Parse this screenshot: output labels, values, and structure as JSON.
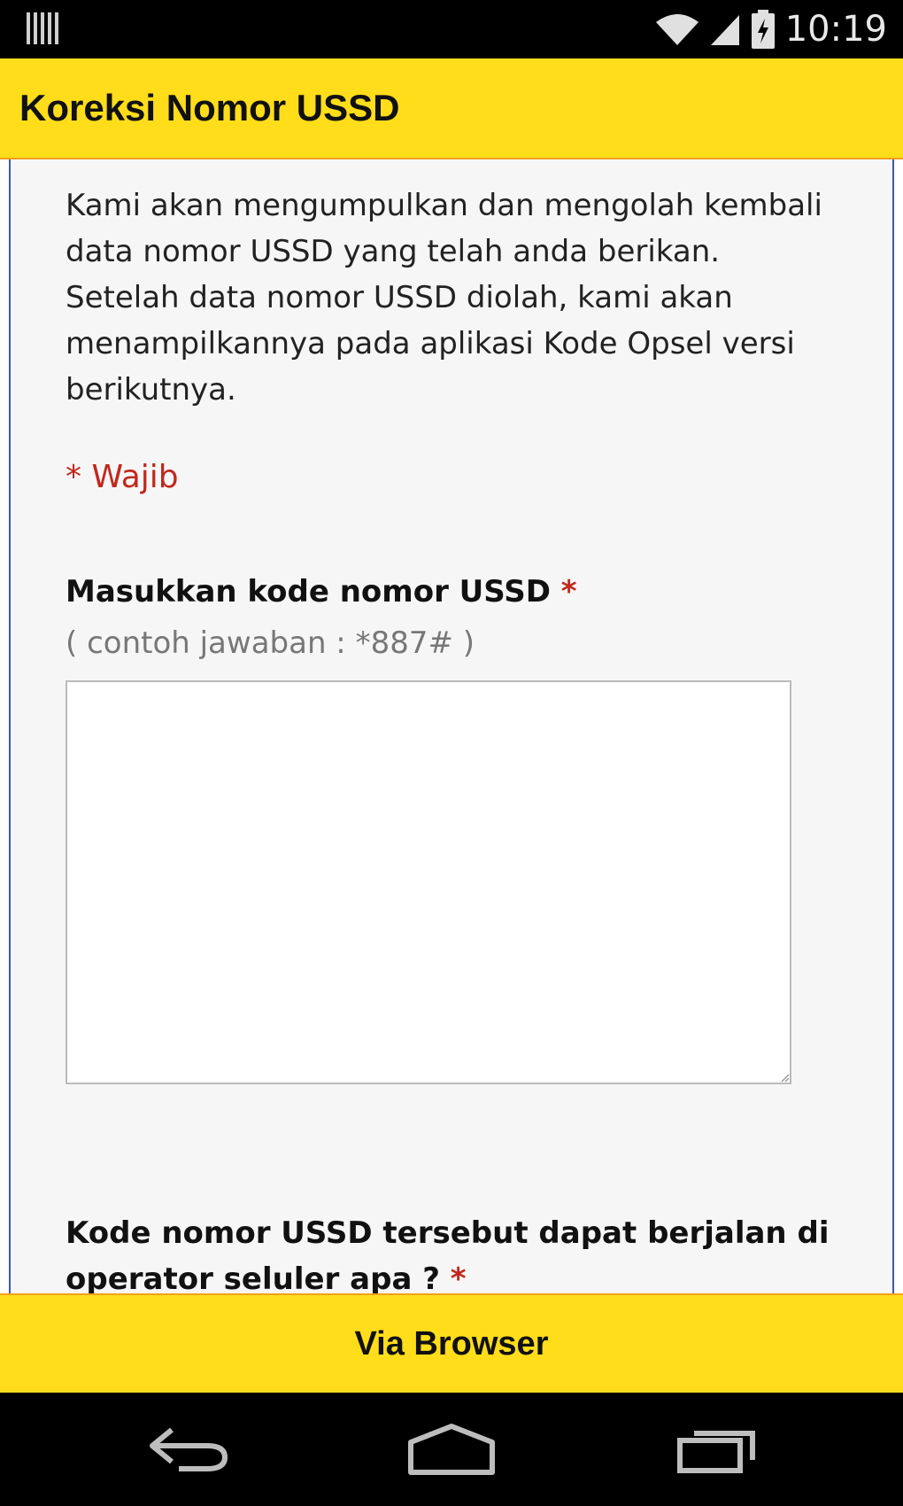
{
  "status_bar": {
    "time": "10:19",
    "icons": [
      "barcode-icon",
      "wifi-icon",
      "signal-icon",
      "battery-charging-icon"
    ]
  },
  "app_bar": {
    "title": "Koreksi Nomor USSD"
  },
  "form": {
    "intro": "Kami akan mengumpulkan dan mengolah kembali data nomor USSD yang telah anda berikan. Setelah data nomor USSD diolah, kami akan menampilkannya pada aplikasi Kode Opsel versi berikutnya.",
    "required_note": "* Wajib",
    "question_1": {
      "label": "Masukkan kode nomor USSD",
      "required_mark": "*",
      "hint": "( contoh jawaban : *887# )",
      "value": ""
    },
    "question_2": {
      "label": "Kode nomor USSD tersebut dapat berjalan di operator seluler apa ?",
      "required_mark": "*"
    }
  },
  "bottom_button": {
    "label": "Via Browser"
  },
  "nav_bar": {
    "icons": [
      "back-icon",
      "home-icon",
      "recent-apps-icon"
    ]
  },
  "colors": {
    "accent": "#ffdd1a",
    "required": "#c0281e",
    "panel_border": "#3b5bb0"
  }
}
